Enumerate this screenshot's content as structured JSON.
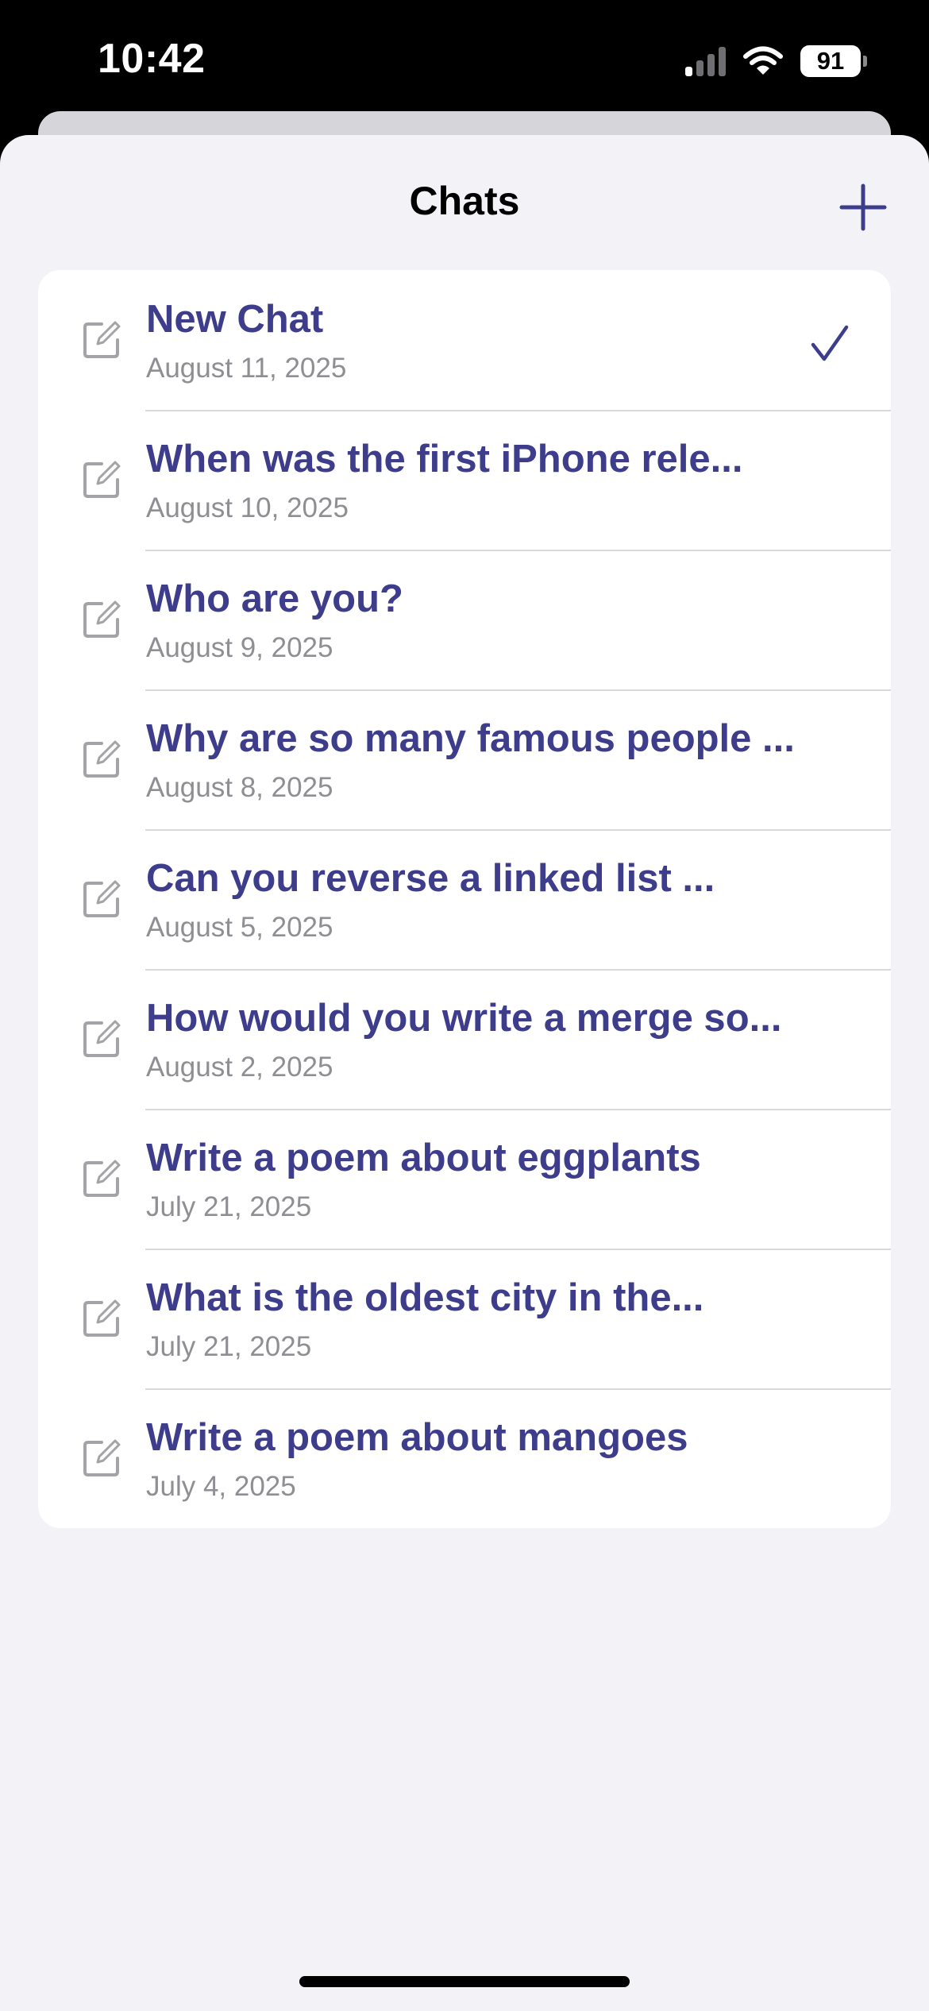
{
  "status_bar": {
    "time": "10:42",
    "battery": "91"
  },
  "header": {
    "title": "Chats"
  },
  "chats": [
    {
      "title": "New Chat",
      "date": "August 11, 2025",
      "selected": true
    },
    {
      "title": "When was the first iPhone rele...",
      "date": "August 10, 2025"
    },
    {
      "title": "Who are you?",
      "date": "August 9, 2025"
    },
    {
      "title": "Why are so many famous people ...",
      "date": "August 8, 2025"
    },
    {
      "title": "Can you reverse a linked list ...",
      "date": "August 5, 2025"
    },
    {
      "title": "How would you write a merge so...",
      "date": "August 2, 2025"
    },
    {
      "title": "Write a poem about eggplants",
      "date": "July 21, 2025"
    },
    {
      "title": "What is the oldest city in the...",
      "date": "July 21, 2025"
    },
    {
      "title": "Write a poem about mangoes",
      "date": "July 4, 2025"
    }
  ],
  "icons": {
    "add": "plus-icon",
    "compose": "compose-icon",
    "selected": "checkmark-icon",
    "signal": "cellular-signal-icon",
    "wifi": "wifi-icon",
    "battery": "battery-icon"
  },
  "colors": {
    "accent": "#3d3d8c",
    "secondary_text": "#8e8e93",
    "sheet_background": "#f2f2f7",
    "card_background": "#ffffff",
    "status_background": "#000000"
  }
}
